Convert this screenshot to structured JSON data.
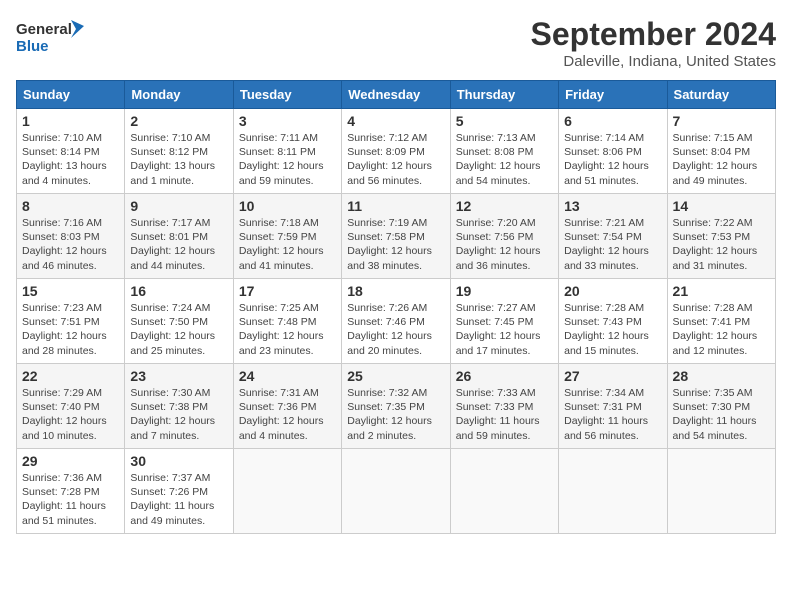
{
  "header": {
    "logo_line1": "General",
    "logo_line2": "Blue",
    "month": "September 2024",
    "location": "Daleville, Indiana, United States"
  },
  "weekdays": [
    "Sunday",
    "Monday",
    "Tuesday",
    "Wednesday",
    "Thursday",
    "Friday",
    "Saturday"
  ],
  "weeks": [
    [
      {
        "day": "1",
        "info": "Sunrise: 7:10 AM\nSunset: 8:14 PM\nDaylight: 13 hours\nand 4 minutes."
      },
      {
        "day": "2",
        "info": "Sunrise: 7:10 AM\nSunset: 8:12 PM\nDaylight: 13 hours\nand 1 minute."
      },
      {
        "day": "3",
        "info": "Sunrise: 7:11 AM\nSunset: 8:11 PM\nDaylight: 12 hours\nand 59 minutes."
      },
      {
        "day": "4",
        "info": "Sunrise: 7:12 AM\nSunset: 8:09 PM\nDaylight: 12 hours\nand 56 minutes."
      },
      {
        "day": "5",
        "info": "Sunrise: 7:13 AM\nSunset: 8:08 PM\nDaylight: 12 hours\nand 54 minutes."
      },
      {
        "day": "6",
        "info": "Sunrise: 7:14 AM\nSunset: 8:06 PM\nDaylight: 12 hours\nand 51 minutes."
      },
      {
        "day": "7",
        "info": "Sunrise: 7:15 AM\nSunset: 8:04 PM\nDaylight: 12 hours\nand 49 minutes."
      }
    ],
    [
      {
        "day": "8",
        "info": "Sunrise: 7:16 AM\nSunset: 8:03 PM\nDaylight: 12 hours\nand 46 minutes."
      },
      {
        "day": "9",
        "info": "Sunrise: 7:17 AM\nSunset: 8:01 PM\nDaylight: 12 hours\nand 44 minutes."
      },
      {
        "day": "10",
        "info": "Sunrise: 7:18 AM\nSunset: 7:59 PM\nDaylight: 12 hours\nand 41 minutes."
      },
      {
        "day": "11",
        "info": "Sunrise: 7:19 AM\nSunset: 7:58 PM\nDaylight: 12 hours\nand 38 minutes."
      },
      {
        "day": "12",
        "info": "Sunrise: 7:20 AM\nSunset: 7:56 PM\nDaylight: 12 hours\nand 36 minutes."
      },
      {
        "day": "13",
        "info": "Sunrise: 7:21 AM\nSunset: 7:54 PM\nDaylight: 12 hours\nand 33 minutes."
      },
      {
        "day": "14",
        "info": "Sunrise: 7:22 AM\nSunset: 7:53 PM\nDaylight: 12 hours\nand 31 minutes."
      }
    ],
    [
      {
        "day": "15",
        "info": "Sunrise: 7:23 AM\nSunset: 7:51 PM\nDaylight: 12 hours\nand 28 minutes."
      },
      {
        "day": "16",
        "info": "Sunrise: 7:24 AM\nSunset: 7:50 PM\nDaylight: 12 hours\nand 25 minutes."
      },
      {
        "day": "17",
        "info": "Sunrise: 7:25 AM\nSunset: 7:48 PM\nDaylight: 12 hours\nand 23 minutes."
      },
      {
        "day": "18",
        "info": "Sunrise: 7:26 AM\nSunset: 7:46 PM\nDaylight: 12 hours\nand 20 minutes."
      },
      {
        "day": "19",
        "info": "Sunrise: 7:27 AM\nSunset: 7:45 PM\nDaylight: 12 hours\nand 17 minutes."
      },
      {
        "day": "20",
        "info": "Sunrise: 7:28 AM\nSunset: 7:43 PM\nDaylight: 12 hours\nand 15 minutes."
      },
      {
        "day": "21",
        "info": "Sunrise: 7:28 AM\nSunset: 7:41 PM\nDaylight: 12 hours\nand 12 minutes."
      }
    ],
    [
      {
        "day": "22",
        "info": "Sunrise: 7:29 AM\nSunset: 7:40 PM\nDaylight: 12 hours\nand 10 minutes."
      },
      {
        "day": "23",
        "info": "Sunrise: 7:30 AM\nSunset: 7:38 PM\nDaylight: 12 hours\nand 7 minutes."
      },
      {
        "day": "24",
        "info": "Sunrise: 7:31 AM\nSunset: 7:36 PM\nDaylight: 12 hours\nand 4 minutes."
      },
      {
        "day": "25",
        "info": "Sunrise: 7:32 AM\nSunset: 7:35 PM\nDaylight: 12 hours\nand 2 minutes."
      },
      {
        "day": "26",
        "info": "Sunrise: 7:33 AM\nSunset: 7:33 PM\nDaylight: 11 hours\nand 59 minutes."
      },
      {
        "day": "27",
        "info": "Sunrise: 7:34 AM\nSunset: 7:31 PM\nDaylight: 11 hours\nand 56 minutes."
      },
      {
        "day": "28",
        "info": "Sunrise: 7:35 AM\nSunset: 7:30 PM\nDaylight: 11 hours\nand 54 minutes."
      }
    ],
    [
      {
        "day": "29",
        "info": "Sunrise: 7:36 AM\nSunset: 7:28 PM\nDaylight: 11 hours\nand 51 minutes."
      },
      {
        "day": "30",
        "info": "Sunrise: 7:37 AM\nSunset: 7:26 PM\nDaylight: 11 hours\nand 49 minutes."
      },
      {
        "day": "",
        "info": ""
      },
      {
        "day": "",
        "info": ""
      },
      {
        "day": "",
        "info": ""
      },
      {
        "day": "",
        "info": ""
      },
      {
        "day": "",
        "info": ""
      }
    ]
  ]
}
